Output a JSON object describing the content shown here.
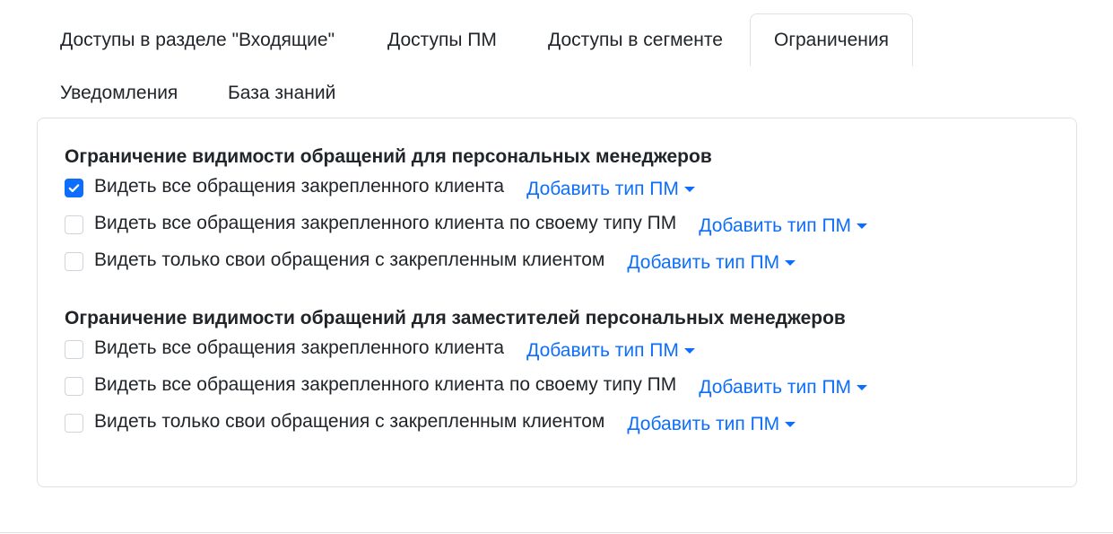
{
  "tabs": [
    {
      "label": "Доступы в разделе \"Входящие\""
    },
    {
      "label": "Доступы ПМ"
    },
    {
      "label": "Доступы в сегменте"
    },
    {
      "label": "Ограничения"
    },
    {
      "label": "Уведомления"
    },
    {
      "label": "База знаний"
    }
  ],
  "active_tab": "Ограничения",
  "sections": [
    {
      "title": "Ограничение видимости обращений для персональных менеджеров",
      "rows": [
        {
          "label": "Видеть все обращения закрепленного клиента",
          "checked": true,
          "dropdown": "Добавить тип ПМ"
        },
        {
          "label": "Видеть все обращения закрепленного клиента по своему типу ПМ",
          "checked": false,
          "dropdown": "Добавить тип ПМ"
        },
        {
          "label": "Видеть только свои обращения с закрепленным клиентом",
          "checked": false,
          "dropdown": "Добавить тип ПМ"
        }
      ]
    },
    {
      "title": "Ограничение видимости обращений для заместителей персональных менеджеров",
      "rows": [
        {
          "label": "Видеть все обращения закрепленного клиента",
          "checked": false,
          "dropdown": "Добавить тип ПМ"
        },
        {
          "label": "Видеть все обращения закрепленного клиента по своему типу ПМ",
          "checked": false,
          "dropdown": "Добавить тип ПМ"
        },
        {
          "label": "Видеть только свои обращения с закрепленным клиентом",
          "checked": false,
          "dropdown": "Добавить тип ПМ"
        }
      ]
    }
  ],
  "colors": {
    "accent": "#0d6efd",
    "border": "#dee2e6",
    "text": "#212529"
  }
}
